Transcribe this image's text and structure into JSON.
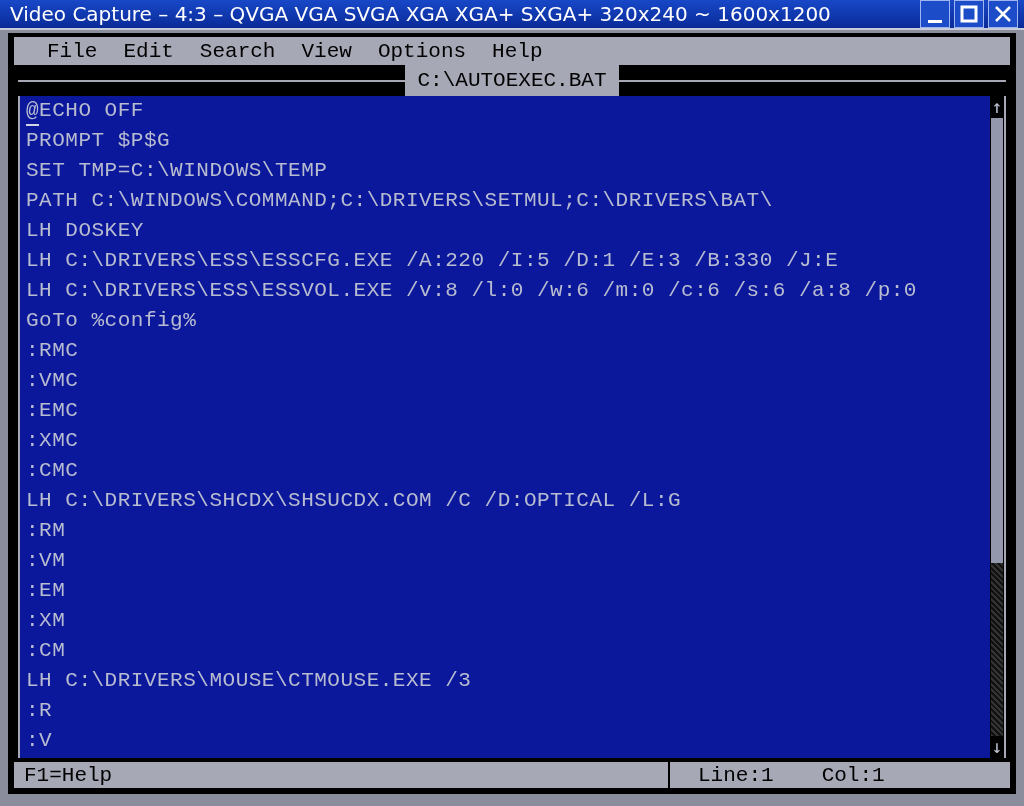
{
  "window": {
    "title": "Video Capture – 4:3 – QVGA VGA SVGA XGA XGA+ SXGA+ 320x240 ~ 1600x1200"
  },
  "menu": [
    "File",
    "Edit",
    "Search",
    "View",
    "Options",
    "Help"
  ],
  "document": {
    "title": "C:\\AUTOEXEC.BAT"
  },
  "lines": [
    "@ECHO OFF",
    "PROMPT $P$G",
    "SET TMP=C:\\WINDOWS\\TEMP",
    "PATH C:\\WINDOWS\\COMMAND;C:\\DRIVERS\\SETMUL;C:\\DRIVERS\\BAT\\",
    "LH DOSKEY",
    "LH C:\\DRIVERS\\ESS\\ESSCFG.EXE /A:220 /I:5 /D:1 /E:3 /B:330 /J:E",
    "LH C:\\DRIVERS\\ESS\\ESSVOL.EXE /v:8 /l:0 /w:6 /m:0 /c:6 /s:6 /a:8 /p:0",
    "GoTo %config%",
    ":RMC",
    ":VMC",
    ":EMC",
    ":XMC",
    ":CMC",
    "LH C:\\DRIVERS\\SHCDX\\SHSUCDX.COM /C /D:OPTICAL /L:G",
    ":RM",
    ":VM",
    ":EM",
    ":XM",
    ":CM",
    "LH C:\\DRIVERS\\MOUSE\\CTMOUSE.EXE /3",
    ":R",
    ":V"
  ],
  "scrollbar": {
    "up_arrow": "↑",
    "down_arrow": "↓"
  },
  "status_bar": {
    "help": "F1=Help",
    "line": "Line:1",
    "col": "Col:1"
  }
}
